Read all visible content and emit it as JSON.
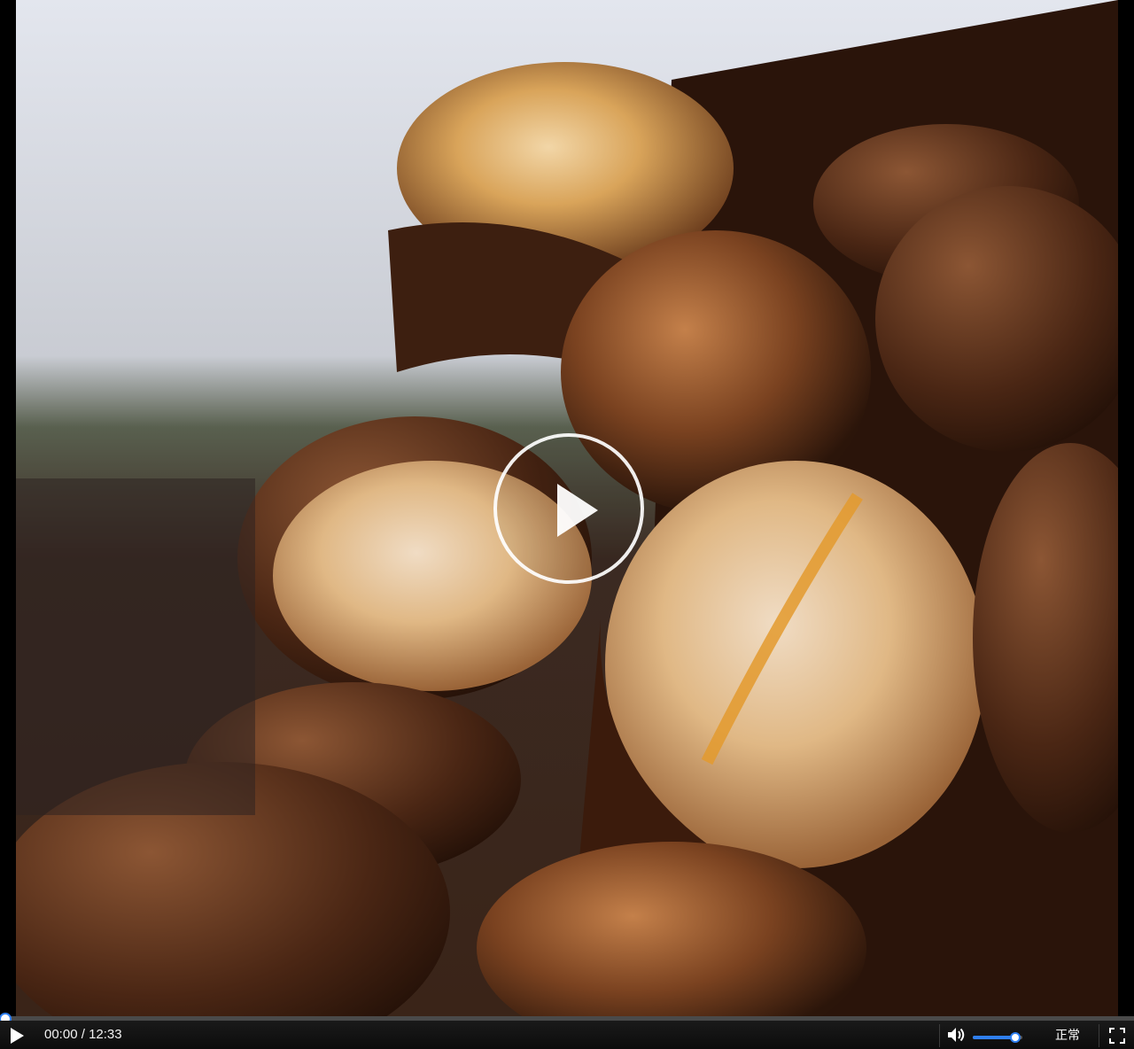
{
  "player": {
    "current_time": "00:00",
    "time_separator": " / ",
    "duration": "12:33",
    "time_display": "00:00 / 12:33",
    "rate_label": "正常",
    "progress_fraction": 0.005,
    "volume_fraction": 0.85,
    "accent_color": "#2f7ff0",
    "icons": {
      "big_play": "play-circle-icon",
      "play": "play-icon",
      "volume": "volume-icon",
      "fullscreen": "fullscreen-icon"
    }
  }
}
